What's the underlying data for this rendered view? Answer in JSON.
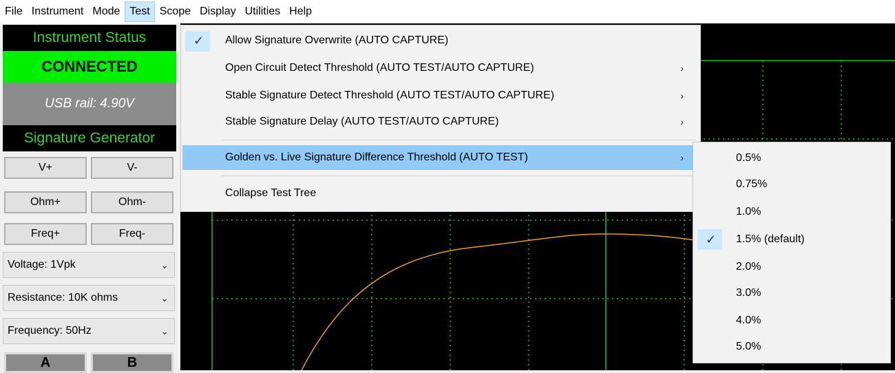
{
  "menubar": {
    "items": [
      "File",
      "Instrument",
      "Mode",
      "Test",
      "Scope",
      "Display",
      "Utilities",
      "Help"
    ],
    "active": "Test"
  },
  "panel": {
    "status_title": "Instrument Status",
    "connected": "CONNECTED",
    "usb_rail": "USB rail: 4.90V",
    "siggen_title": "Signature Generator",
    "buttons": {
      "v_plus": "V+",
      "v_minus": "V-",
      "ohm_plus": "Ohm+",
      "ohm_minus": "Ohm-",
      "freq_plus": "Freq+",
      "freq_minus": "Freq-",
      "a": "A",
      "b": "B"
    },
    "selects": {
      "voltage": "Voltage: 1Vpk",
      "resistance": "Resistance: 10K ohms",
      "frequency": "Frequency: 50Hz"
    }
  },
  "test_menu": {
    "items": [
      {
        "label": "Allow Signature Overwrite (AUTO CAPTURE)",
        "checked": true,
        "submenu": false
      },
      {
        "label": "Open Circuit Detect Threshold (AUTO TEST/AUTO CAPTURE)",
        "checked": false,
        "submenu": true
      },
      {
        "label": "Stable Signature Detect Threshold (AUTO TEST/AUTO CAPTURE)",
        "checked": false,
        "submenu": true
      },
      {
        "label": "Stable Signature Delay (AUTO TEST/AUTO CAPTURE)",
        "checked": false,
        "submenu": true
      },
      {
        "label": "Golden vs. Live Signature Difference Threshold (AUTO TEST)",
        "checked": false,
        "submenu": true,
        "highlighted": true
      },
      {
        "label": "Collapse Test Tree",
        "checked": false,
        "submenu": false
      }
    ]
  },
  "threshold_submenu": {
    "options": [
      "0.5%",
      "0.75%",
      "1.0%",
      "1.5% (default)",
      "2.0%",
      "3.0%",
      "4.0%",
      "5.0%"
    ],
    "selected": "1.5% (default)"
  },
  "colors": {
    "scope_bg": "#000000",
    "grid": "#19c519",
    "trace": "#e8a020",
    "connected": "#00f000",
    "menu_highlight": "#91c9f7"
  }
}
